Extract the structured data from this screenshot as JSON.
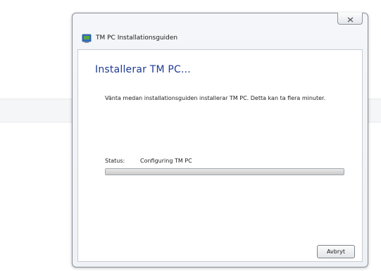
{
  "window": {
    "title": "TM PC Installationsguiden",
    "close_icon": "close-x-icon",
    "app_icon": "installer-icon"
  },
  "content": {
    "heading": "Installerar TM PC...",
    "description": "Vänta medan installationsguiden installerar TM PC. Detta kan ta flera minuter.",
    "status_label": "Status:",
    "status_value": "Configuring TM PC",
    "progress_fraction": 1.0
  },
  "buttons": {
    "cancel_label": "Avbryt"
  },
  "colors": {
    "heading": "#1f3a93",
    "icon_blue": "#2f6fc0",
    "icon_green": "#5aa542"
  }
}
